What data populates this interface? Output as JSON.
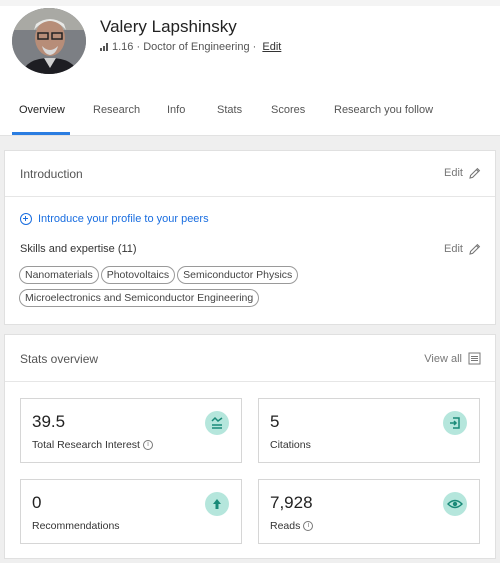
{
  "profile": {
    "name": "Valery Lapshinsky",
    "score": "1.16",
    "separator_1": " · ",
    "degree": "Doctor of Engineering",
    "separator_2": " · ",
    "edit_label": "Edit"
  },
  "tabs": [
    {
      "label": "Overview",
      "active": true
    },
    {
      "label": "Research",
      "active": false
    },
    {
      "label": "Info",
      "active": false
    },
    {
      "label": "Stats",
      "active": false
    },
    {
      "label": "Scores",
      "active": false
    },
    {
      "label": "Research you follow",
      "active": false
    }
  ],
  "introduction": {
    "title": "Introduction",
    "edit_label": "Edit",
    "introduce_link": "Introduce your profile to your peers",
    "skills_label": "Skills and expertise (11)",
    "skills_edit_label": "Edit",
    "skills": [
      "Nanomaterials",
      "Photovoltaics",
      "Semiconductor Physics",
      "Microelectronics and Semiconductor Engineering"
    ]
  },
  "stats": {
    "title": "Stats overview",
    "view_all_label": "View all",
    "items": [
      {
        "value": "39.5",
        "label": "Total Research Interest",
        "info": true,
        "icon": "research-interest-icon"
      },
      {
        "value": "5",
        "label": "Citations",
        "info": false,
        "icon": "citation-icon"
      },
      {
        "value": "0",
        "label": "Recommendations",
        "info": false,
        "icon": "arrow-up-icon"
      },
      {
        "value": "7,928",
        "label": "Reads",
        "info": true,
        "icon": "eye-icon"
      }
    ]
  },
  "colors": {
    "accent": "#2a7de1",
    "link": "#1a6ee0",
    "icon_bg": "#b5e6dc",
    "icon_fg": "#1a8a78"
  }
}
